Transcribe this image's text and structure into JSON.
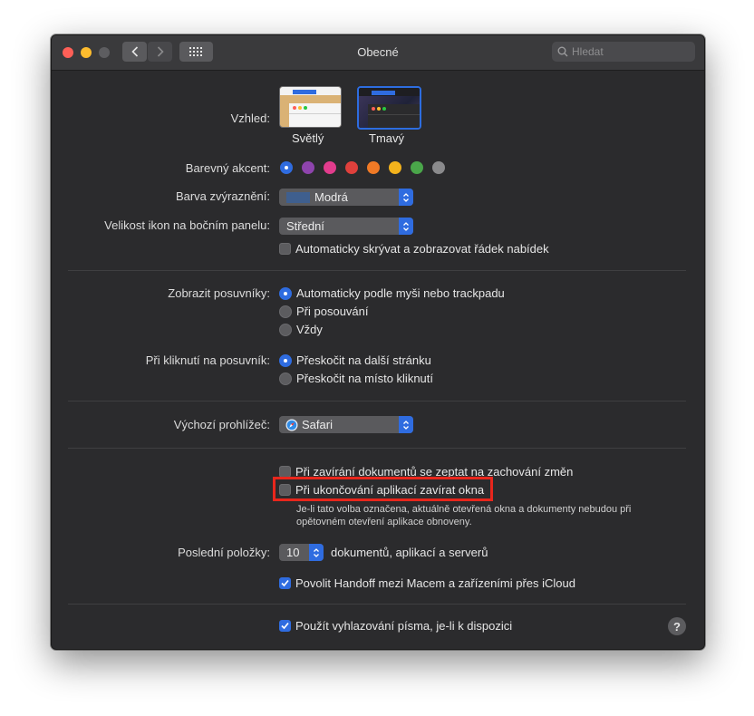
{
  "window": {
    "title": "Obecné"
  },
  "search": {
    "placeholder": "Hledat"
  },
  "appearance": {
    "label": "Vzhled:",
    "options": [
      {
        "label": "Světlý"
      },
      {
        "label": "Tmavý"
      }
    ],
    "selected": "Tmavý"
  },
  "accent": {
    "label": "Barevný akcent:",
    "colors": [
      "#2f6ce0",
      "#8e44ad",
      "#e23c8d",
      "#e0403c",
      "#f07a26",
      "#f3b21c",
      "#4aa64a",
      "#8a8a8c"
    ],
    "selected_index": 0
  },
  "highlight_color": {
    "label": "Barva zvýraznění:",
    "value": "Modrá",
    "swatch": "#3f5f8e"
  },
  "sidebar_icon_size": {
    "label": "Velikost ikon na bočním panelu:",
    "value": "Střední"
  },
  "auto_hide_menu": {
    "label": "Automaticky skrývat a zobrazovat řádek nabídek",
    "checked": false
  },
  "show_scrollbars": {
    "label": "Zobrazit posuvníky:",
    "options": [
      "Automaticky podle myši nebo trackpadu",
      "Při posouvání",
      "Vždy"
    ],
    "selected_index": 0
  },
  "click_scrollbar": {
    "label": "Při kliknutí na posuvník:",
    "options": [
      "Přeskočit na další stránku",
      "Přeskočit na místo kliknutí"
    ],
    "selected_index": 0
  },
  "default_browser": {
    "label": "Výchozí prohlížeč:",
    "value": "Safari"
  },
  "ask_keep_changes": {
    "label": "Při zavírání dokumentů se zeptat na zachování změn",
    "checked": false
  },
  "close_windows": {
    "label": "Při ukončování aplikací zavírat okna",
    "checked": false,
    "note_line1": "Je-li tato volba označena, aktuálně otevřená okna a dokumenty nebudou při",
    "note_line2": "opětovném otevření aplikace obnoveny."
  },
  "recent_items": {
    "label": "Poslední položky:",
    "value": "10",
    "suffix": "dokumentů, aplikací a serverů"
  },
  "handoff": {
    "label": "Povolit Handoff mezi Macem a zařízeními přes iCloud",
    "checked": true
  },
  "font_smoothing": {
    "label": "Použít vyhlazování písma, je-li k dispozici",
    "checked": true
  },
  "help": {
    "label": "?"
  },
  "colors": {
    "accent": "#2f6ce0",
    "background": "#2b2b2d",
    "highlight_box": "#e8261c"
  }
}
